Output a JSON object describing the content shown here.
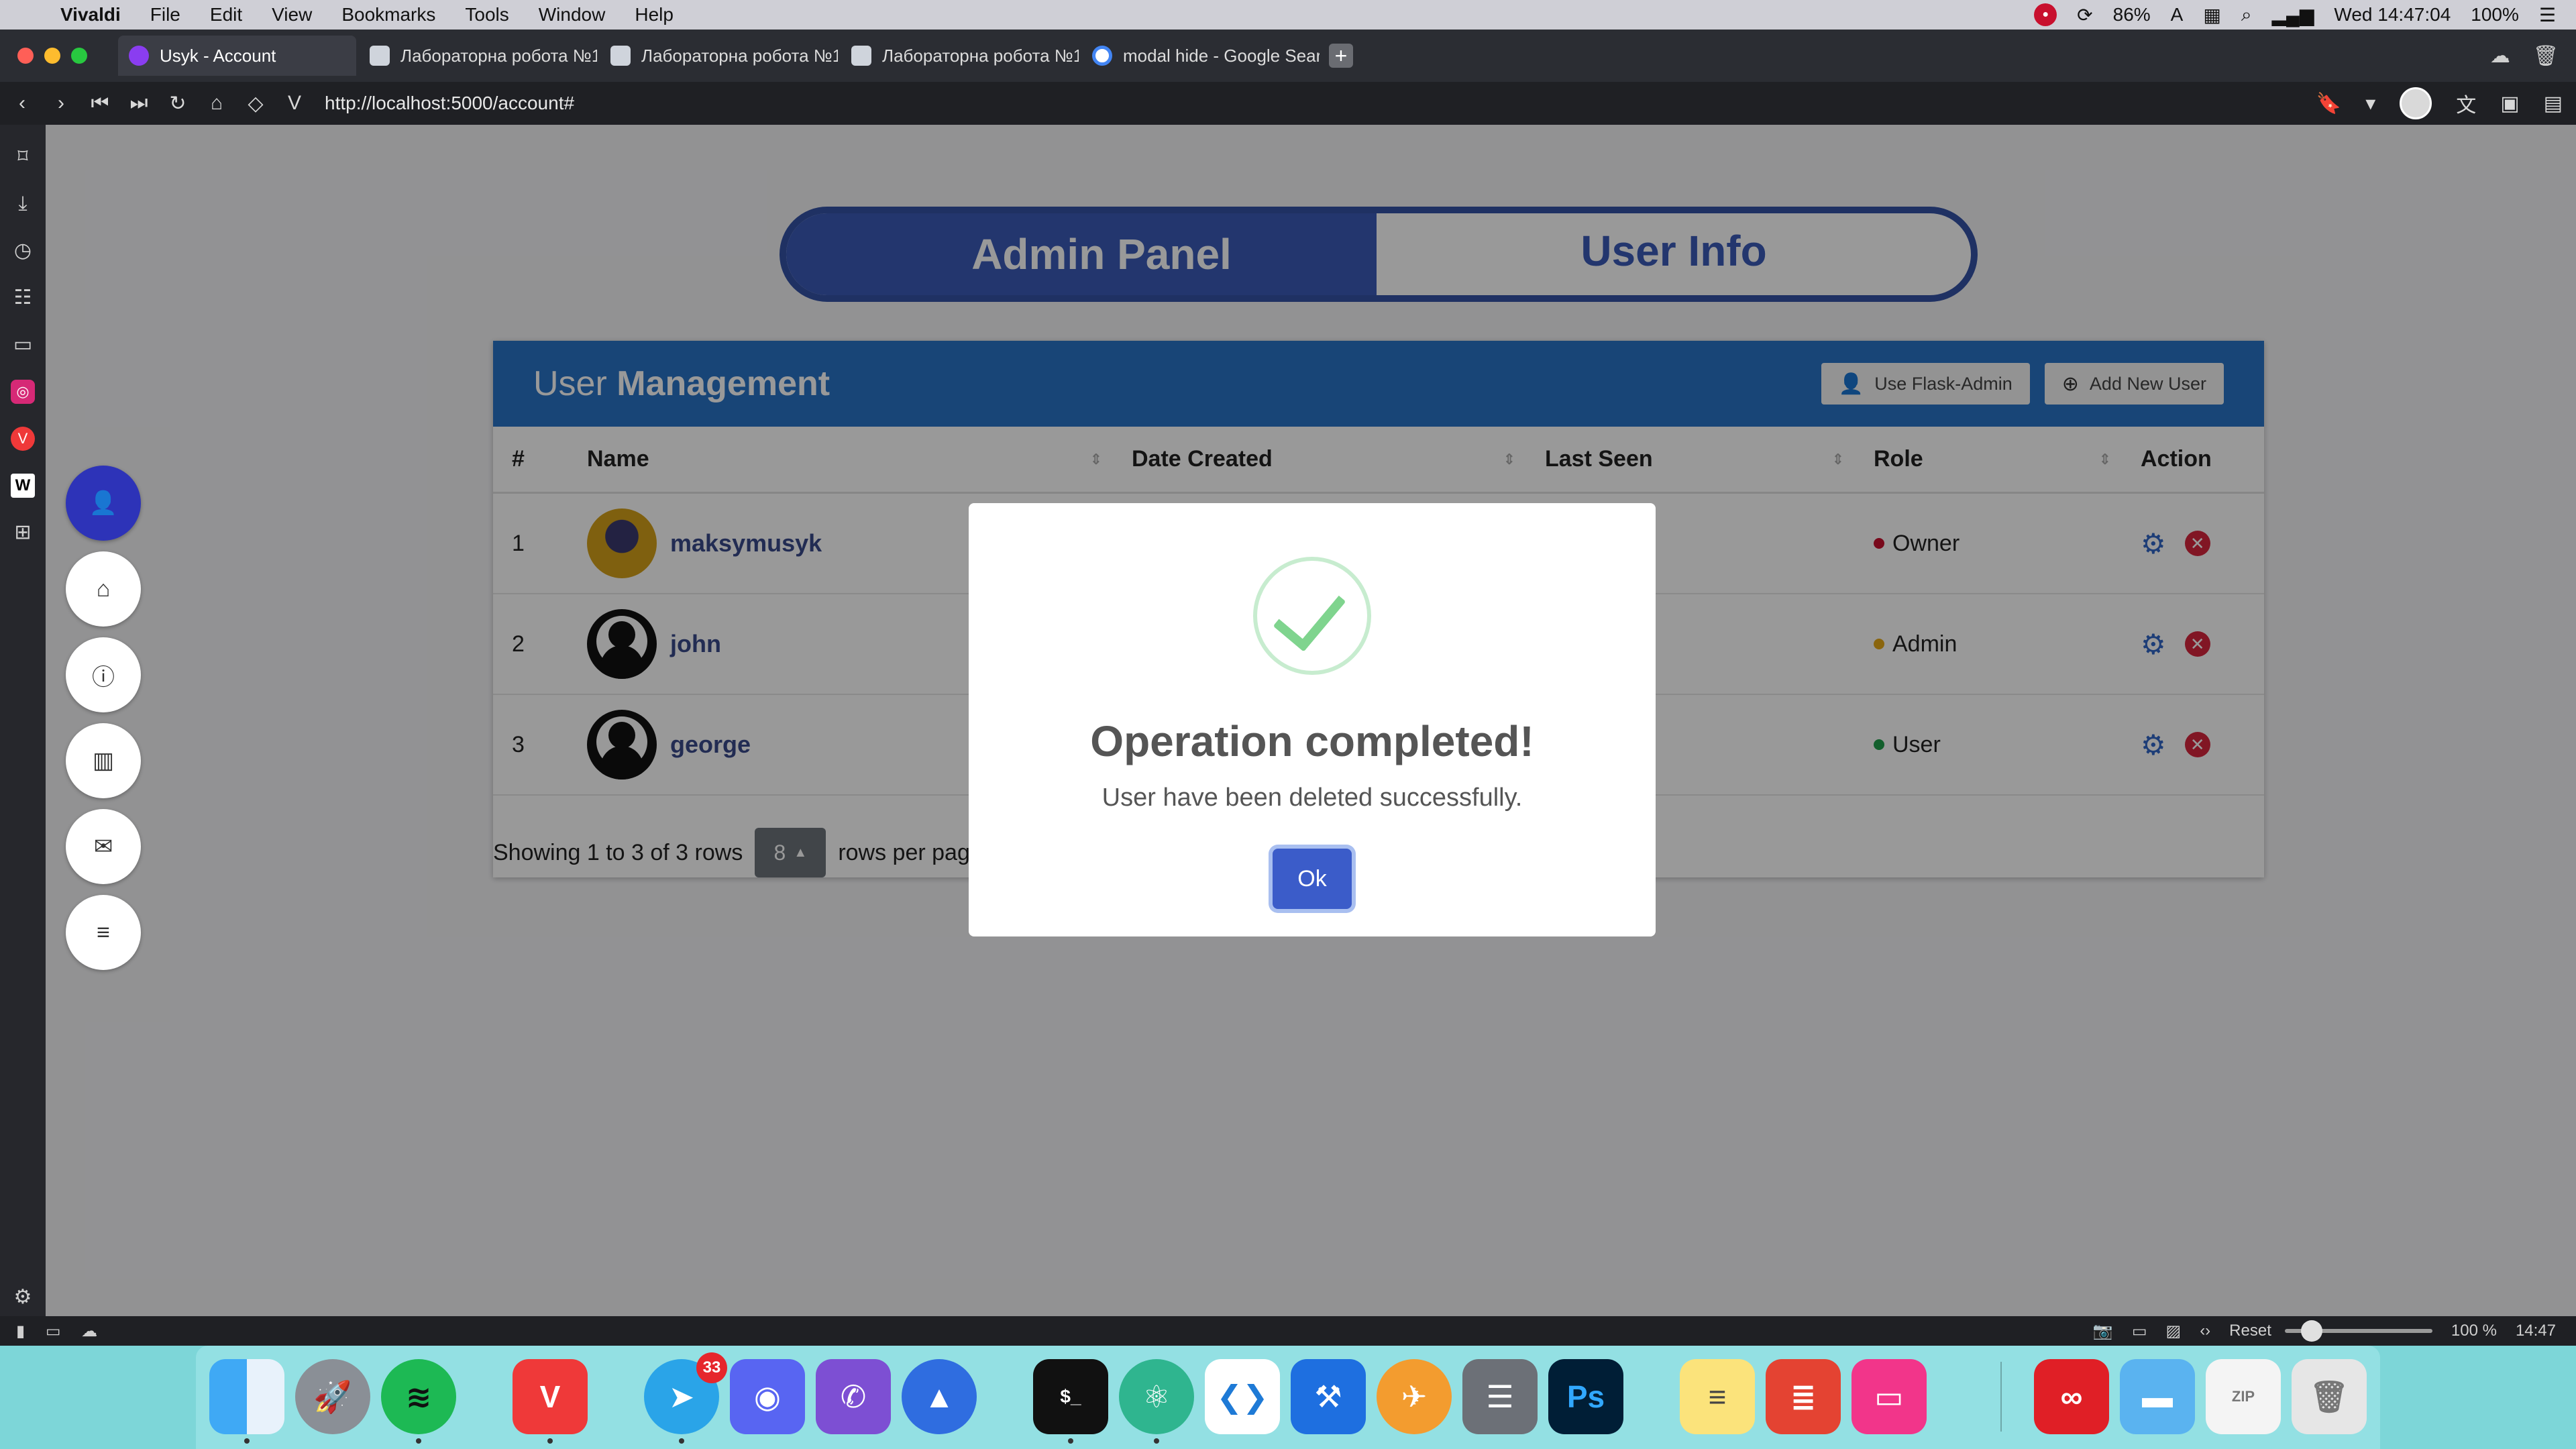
{
  "menubar": {
    "app": "Vivaldi",
    "menus": [
      "File",
      "Edit",
      "View",
      "Bookmarks",
      "Tools",
      "Window",
      "Help"
    ],
    "battery_pct": "86%",
    "clock": "Wed 14:47:04",
    "power": "100%"
  },
  "tabs": [
    {
      "title": "Usyk - Account",
      "active": true
    },
    {
      "title": "Лабораторна робота №1",
      "active": false
    },
    {
      "title": "Лабораторна робота №1",
      "active": false
    },
    {
      "title": "Лабораторна робота №1",
      "active": false
    },
    {
      "title": "modal hide - Google Sear",
      "active": false
    }
  ],
  "address": {
    "url": "http://localhost:5000/account#"
  },
  "toggle": {
    "left": "Admin Panel",
    "right": "User Info"
  },
  "card": {
    "title_light": "User",
    "title_bold": "Management",
    "btn_flask": "Use Flask-Admin",
    "btn_add": "Add New User"
  },
  "table": {
    "headers": [
      "#",
      "Name",
      "Date Created",
      "Last Seen",
      "Role",
      "Action"
    ],
    "rows": [
      {
        "num": "1",
        "name": "maksymusyk",
        "role": "Owner",
        "role_color": "#c8102e"
      },
      {
        "num": "2",
        "name": "john",
        "role": "Admin",
        "role_color": "#e6a817"
      },
      {
        "num": "3",
        "name": "george",
        "role": "User",
        "role_color": "#1e9e4a"
      }
    ]
  },
  "pager": {
    "showing": "Showing 1 to 3 of 3 rows",
    "per_page": "8",
    "suffix": "rows per page"
  },
  "modal": {
    "title": "Operation completed!",
    "message": "User have been deleted successfully.",
    "ok": "Ok"
  },
  "statusbar": {
    "zoom_reset": "Reset",
    "zoom": "100 %",
    "time": "14:47"
  },
  "dock": {
    "telegram_badge": "33"
  },
  "colors": {
    "primary": "#3b5bb7",
    "header": "#2874c7",
    "success": "#7fd48e"
  }
}
